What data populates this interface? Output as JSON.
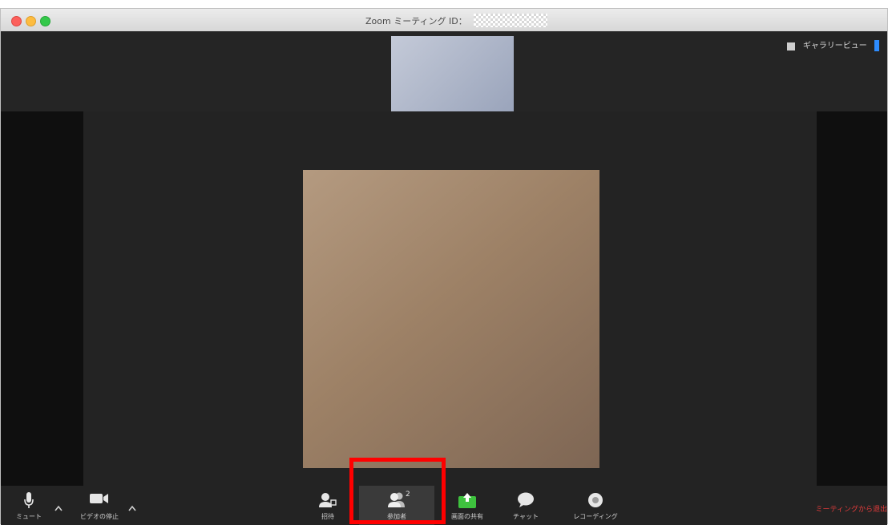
{
  "window": {
    "title": "Zoom ミーティング ID：",
    "colors": {
      "accent": "#2d8cff",
      "leave": "#e23b3b",
      "highlight": "#ff0000"
    }
  },
  "top": {
    "gallery_view_label": "ギャラリービュー"
  },
  "toolbar": {
    "mute": {
      "label": "ミュート",
      "icon": "microphone-icon"
    },
    "video": {
      "label": "ビデオの停止",
      "icon": "video-camera-icon"
    },
    "invite": {
      "label": "招待",
      "icon": "invite-user-icon"
    },
    "participants": {
      "label": "参加者",
      "count": "2",
      "icon": "participants-icon"
    },
    "share": {
      "label": "画面の共有",
      "icon": "share-screen-icon"
    },
    "chat": {
      "label": "チャット",
      "icon": "chat-bubble-icon"
    },
    "record": {
      "label": "レコーディング",
      "icon": "record-icon"
    },
    "leave": {
      "label": "ミーティングから退出"
    }
  }
}
